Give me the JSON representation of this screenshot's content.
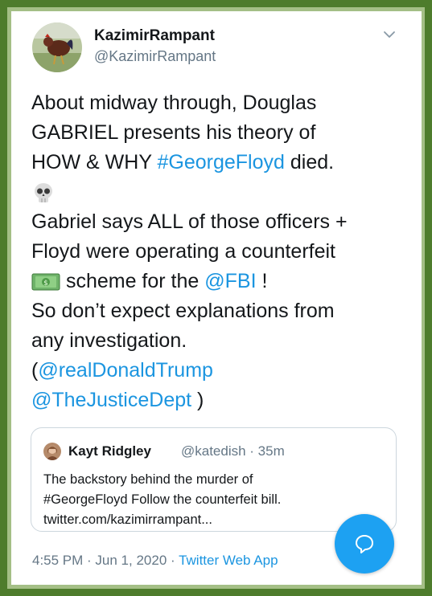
{
  "tweet": {
    "display_name": "KazimirRampant",
    "handle": "@KazimirRampant",
    "lines": [
      {
        "parts": [
          {
            "text": "About midway through, Douglas"
          }
        ]
      },
      {
        "parts": [
          {
            "text": "GABRIEL presents his theory of"
          }
        ]
      },
      {
        "parts": [
          {
            "text": "HOW & WHY "
          },
          {
            "text": "#GeorgeFloyd",
            "link": true
          },
          {
            "text": " died."
          }
        ]
      },
      {
        "parts": [
          {
            "emoji": "skull"
          }
        ]
      },
      {
        "parts": [
          {
            "text": "Gabriel says ALL of those officers +"
          }
        ]
      },
      {
        "parts": [
          {
            "text": "Floyd were operating a counterfeit"
          }
        ]
      },
      {
        "parts": [
          {
            "emoji": "dollar"
          },
          {
            "text": " scheme for the "
          },
          {
            "text": "@FBI",
            "link": true
          },
          {
            "text": " !"
          }
        ]
      },
      {
        "parts": [
          {
            "text": "So don’t expect explanations from"
          }
        ]
      },
      {
        "parts": [
          {
            "text": "any investigation."
          }
        ]
      },
      {
        "parts": [
          {
            "text": "("
          },
          {
            "text": "@realDonaldTrump",
            "link": true
          }
        ]
      },
      {
        "parts": [
          {
            "text": "@TheJusticeDept",
            "link": true
          },
          {
            "text": " )"
          }
        ]
      }
    ]
  },
  "quote": {
    "name": "Kayt Ridgley",
    "handle": "@katedish",
    "time": "35m",
    "handle_time": "@katedish · 35m",
    "lines": [
      "The backstory behind the murder of",
      "#GeorgeFloyd Follow the counterfeit bill.",
      "twitter.com/kazimirrampant..."
    ]
  },
  "meta": {
    "time": "4:55 PM",
    "date": "Jun 1, 2020",
    "time_date": "4:55 PM · Jun 1, 2020 · ",
    "source": "Twitter Web App"
  },
  "colors": {
    "link": "#1b95e0",
    "frame_outer": "#4e7c2c",
    "frame_inner": "#a4bf86",
    "fab": "#1da1f2"
  },
  "icons": {
    "avatar": "rooster-avatar",
    "chevron": "chevron-down-icon",
    "fab": "compose-reply-icon",
    "emoji_1": "skull-emoji",
    "emoji_2": "dollar-bill-emoji"
  }
}
